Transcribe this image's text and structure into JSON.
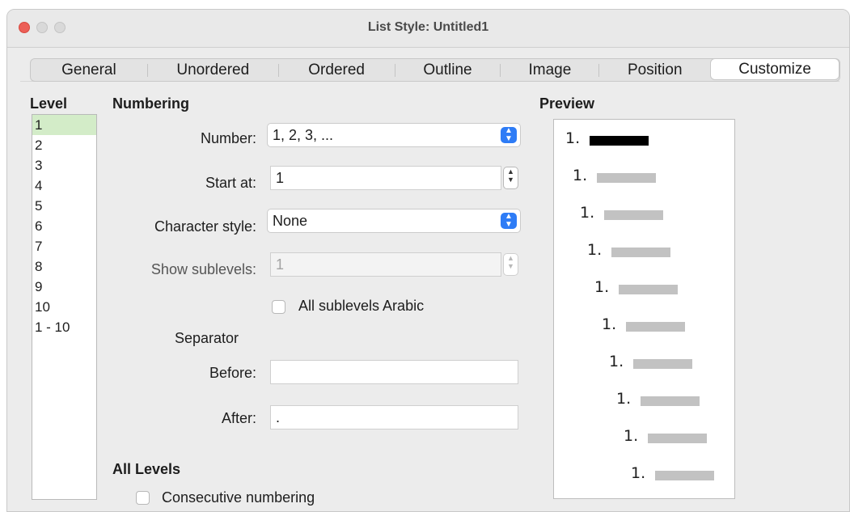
{
  "window": {
    "title": "List Style: Untitled1"
  },
  "tabs": [
    "General",
    "Unordered",
    "Ordered",
    "Outline",
    "Image",
    "Position",
    "Customize"
  ],
  "active_tab": "Customize",
  "level": {
    "header": "Level",
    "items": [
      "1",
      "2",
      "3",
      "4",
      "5",
      "6",
      "7",
      "8",
      "9",
      "10",
      "1 - 10"
    ],
    "selected": "1"
  },
  "numbering": {
    "header": "Numbering",
    "number_label": "Number:",
    "number_value": "1, 2, 3, ...",
    "start_label": "Start at:",
    "start_value": "1",
    "char_style_label": "Character style:",
    "char_style_value": "None",
    "sublevels_label": "Show sublevels:",
    "sublevels_value": "1",
    "all_sublevels_arabic": "All sublevels Arabic",
    "separator_label": "Separator",
    "before_label": "Before:",
    "before_value": "",
    "after_label": "After:",
    "after_value": "."
  },
  "all_levels": {
    "header": "All Levels",
    "consecutive": "Consecutive numbering"
  },
  "preview": {
    "header": "Preview",
    "items": [
      "1.",
      "1.",
      "1.",
      "1.",
      "1.",
      "1.",
      "1.",
      "1.",
      "1.",
      "1."
    ]
  },
  "colors": {
    "accent": "#2e7cf6",
    "selected_level": "#d3ecc8",
    "close": "#ec5f57"
  }
}
